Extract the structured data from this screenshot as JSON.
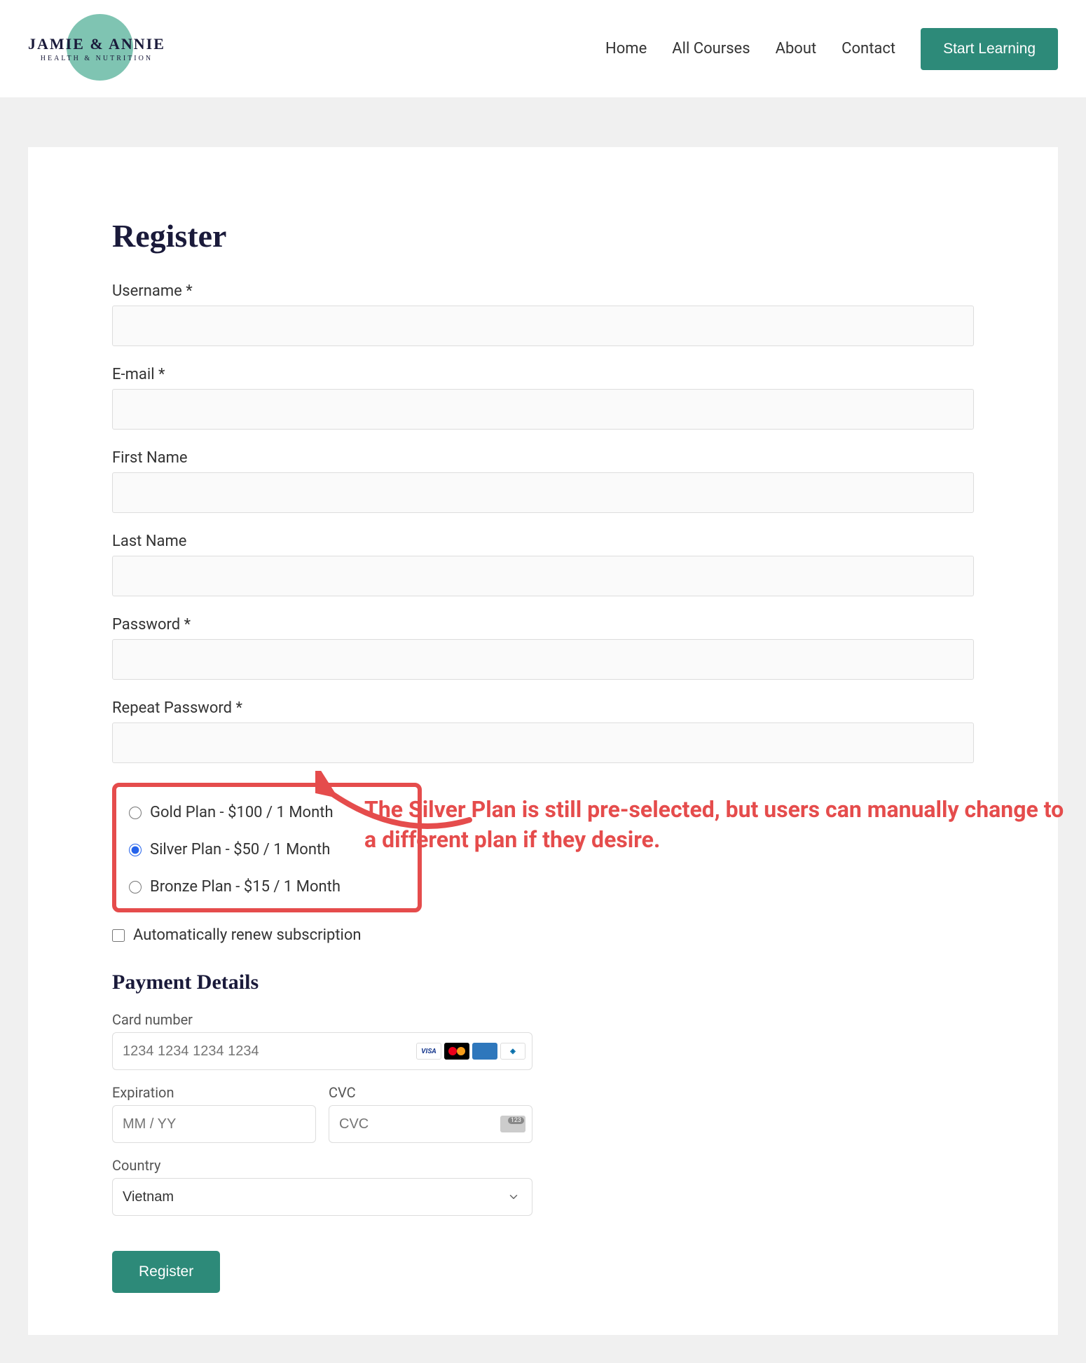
{
  "logo": {
    "main": "JAMIE & ANNIE",
    "sub": "HEALTH & NUTRITION"
  },
  "nav": {
    "home": "Home",
    "courses": "All Courses",
    "about": "About",
    "contact": "Contact",
    "cta": "Start Learning"
  },
  "page": {
    "title": "Register"
  },
  "form": {
    "username_label": "Username *",
    "email_label": "E-mail *",
    "firstname_label": "First Name",
    "lastname_label": "Last Name",
    "password_label": "Password *",
    "repeat_label": "Repeat Password *"
  },
  "plans": {
    "gold": "Gold Plan - $100 / 1 Month",
    "silver": "Silver Plan - $50 / 1 Month",
    "bronze": "Bronze Plan - $15 / 1 Month"
  },
  "auto_renew": "Automatically renew subscription",
  "payment": {
    "title": "Payment Details",
    "card_label": "Card number",
    "card_placeholder": "1234 1234 1234 1234",
    "exp_label": "Expiration",
    "exp_placeholder": "MM / YY",
    "cvc_label": "CVC",
    "cvc_placeholder": "CVC",
    "country_label": "Country",
    "country_value": "Vietnam"
  },
  "submit": "Register",
  "annotation": "The Silver Plan is still pre-selected, but users can manually change to a different plan if they desire.",
  "card_brands": {
    "visa": "VISA",
    "diners": "◈",
    "cvc_badge": "123"
  }
}
